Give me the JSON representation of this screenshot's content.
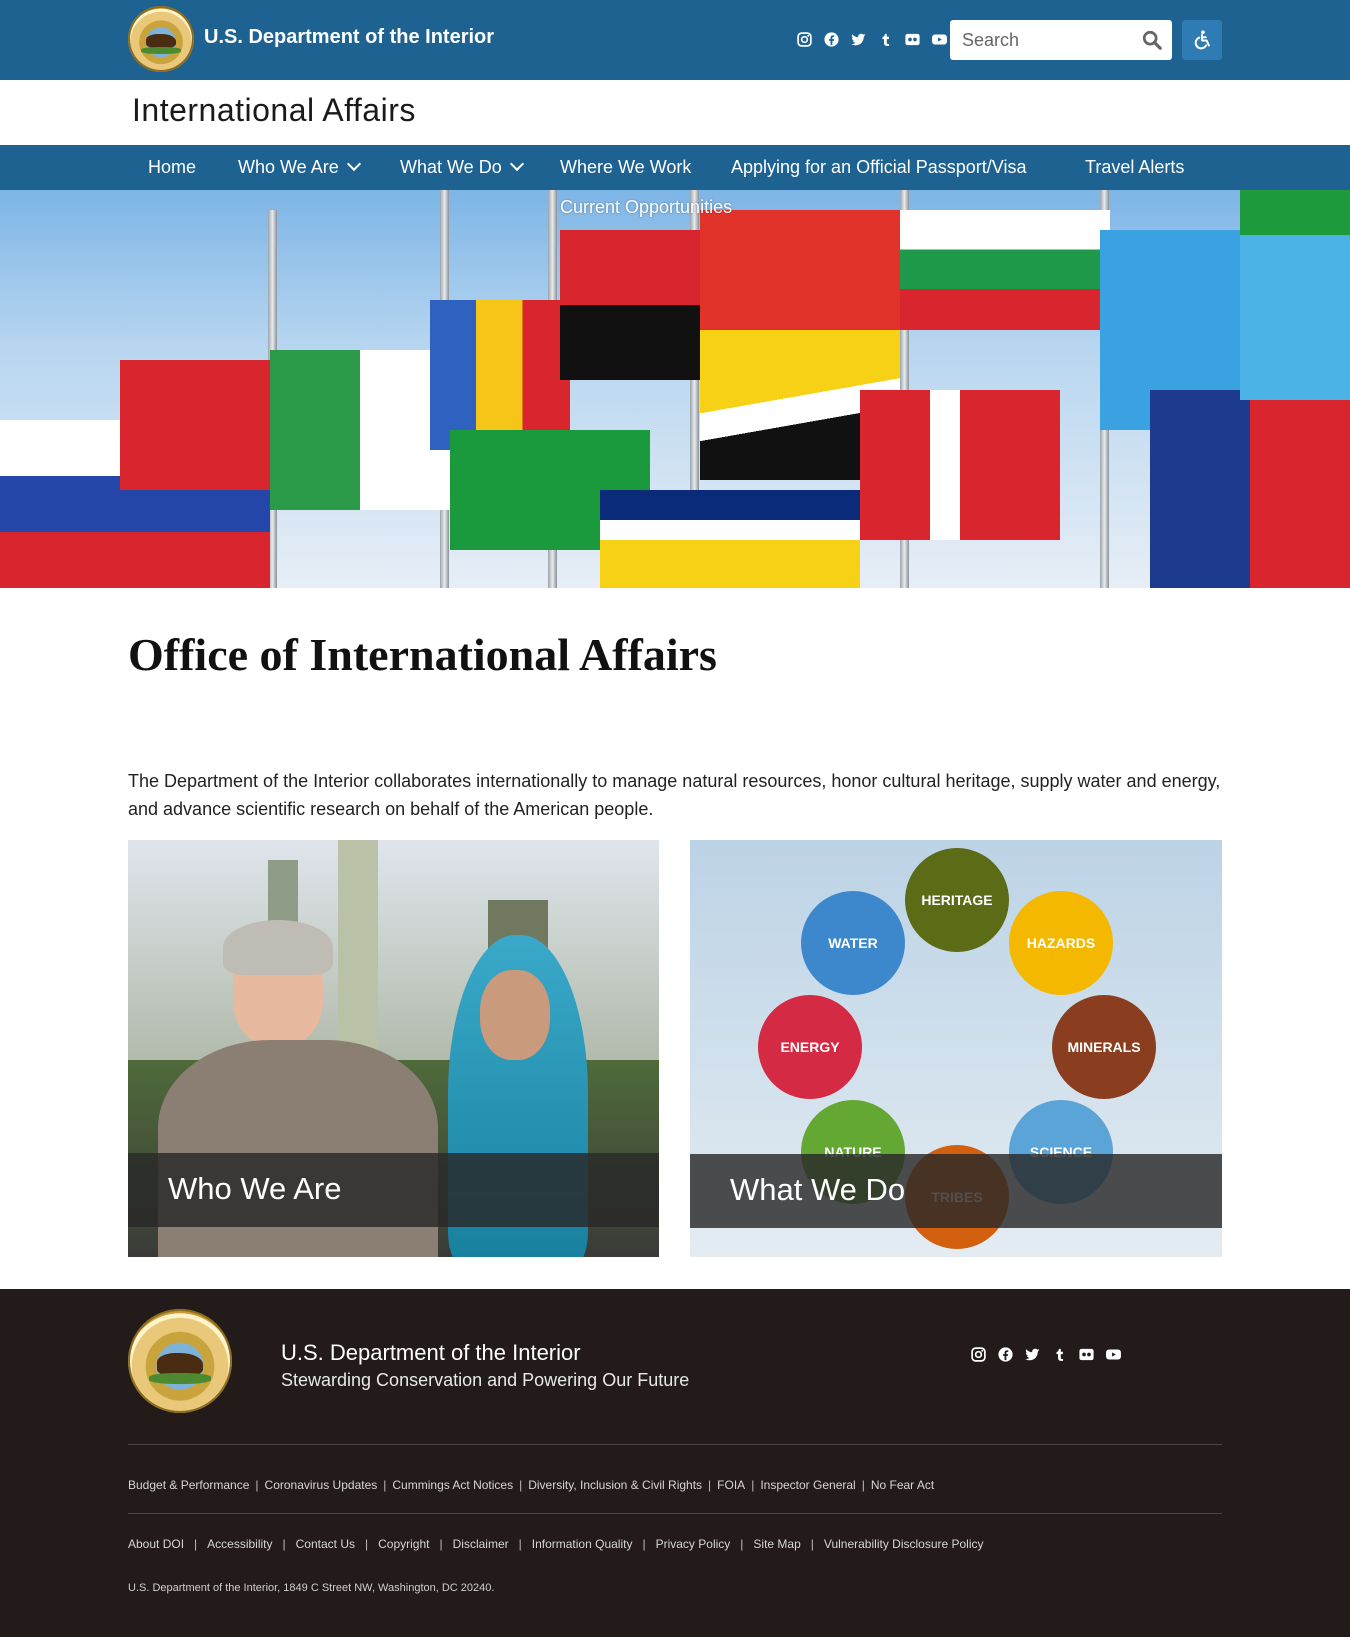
{
  "header": {
    "agency_name": "U.S. Department of the Interior",
    "search": {
      "placeholder": "Search"
    },
    "social_icons": [
      "instagram-icon",
      "facebook-icon",
      "twitter-icon",
      "tumblr-icon",
      "flickr-icon",
      "youtube-icon"
    ],
    "accessibility_icon": "accessibility-icon"
  },
  "site_title": "International Affairs",
  "nav": {
    "items": [
      {
        "label": "Home",
        "has_dropdown": false
      },
      {
        "label": "Who We Are",
        "has_dropdown": true
      },
      {
        "label": "What We Do",
        "has_dropdown": true
      },
      {
        "label": "Where We Work",
        "has_dropdown": false
      },
      {
        "label": "Applying for an Official Passport/Visa",
        "has_dropdown": false
      },
      {
        "label": "Travel Alerts",
        "has_dropdown": false
      },
      {
        "label": "Current Opportunities",
        "has_dropdown": false
      }
    ]
  },
  "main": {
    "heading": "Office of International Affairs",
    "intro": "The Department of the Interior collaborates internationally to manage natural resources, honor cultural heritage, supply water and energy, and advance scientific research on behalf of the American people.",
    "cards": [
      {
        "title": "Who We Are"
      },
      {
        "title": "What We Do",
        "topics": [
          "HERITAGE",
          "WATER",
          "HAZARDS",
          "ENERGY",
          "MINERALS",
          "NATURE",
          "SCIENCE",
          "TRIBES"
        ]
      }
    ]
  },
  "colors": {
    "header_blue": "#1e6291",
    "footer_dark": "#221b19",
    "heritage": "#5b6b16",
    "water": "#3d88cc",
    "hazards": "#f5b800",
    "energy": "#d42a43",
    "minerals": "#8a3e1f",
    "nature": "#63a832",
    "science": "#5aa4d8",
    "tribes": "#d2600e"
  },
  "footer": {
    "agency_name": "U.S. Department of the Interior",
    "tagline": "Stewarding Conservation and Powering Our Future",
    "links_primary": [
      "Budget & Performance",
      "Coronavirus Updates",
      "Cummings Act Notices",
      "Diversity, Inclusion & Civil Rights",
      "FOIA",
      "Inspector General",
      "No Fear Act"
    ],
    "links_secondary": [
      "About DOI",
      "Accessibility",
      "Contact Us",
      "Copyright",
      "Disclaimer",
      "Information Quality",
      "Privacy Policy",
      "Site Map",
      "Vulnerability Disclosure Policy"
    ],
    "address": "U.S. Department of the Interior, 1849 C Street NW, Washington, DC 20240."
  }
}
